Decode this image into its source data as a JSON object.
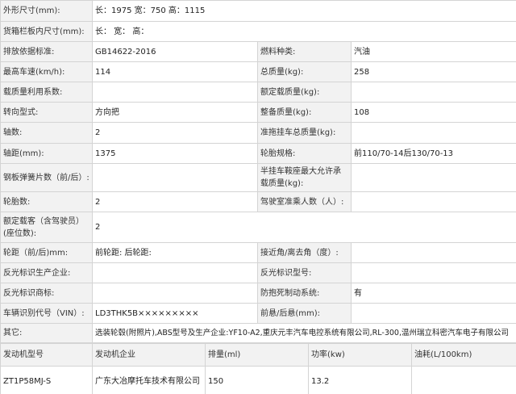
{
  "rows": {
    "dims": {
      "label": "外形尺寸(mm):",
      "value": "长：1975 宽：750 高：1115"
    },
    "cargo_dims": {
      "label": "货箱栏板内尺寸(mm):",
      "value": "长： 宽： 高："
    },
    "standard": {
      "label": "排放依据标准:",
      "value": "GB14622-2016"
    },
    "fuel": {
      "label": "燃料种类:",
      "value": "汽油"
    },
    "max_speed": {
      "label": "最高车速(km/h):",
      "value": "114"
    },
    "total_mass": {
      "label": "总质量(kg):",
      "value": "258"
    },
    "load_util": {
      "label": "载质量利用系数:",
      "value": ""
    },
    "rated_load": {
      "label": "额定载质量(kg):",
      "value": ""
    },
    "steering": {
      "label": "转向型式:",
      "value": "方向把"
    },
    "curb_mass": {
      "label": "整备质量(kg):",
      "value": "108"
    },
    "axles": {
      "label": "轴数:",
      "value": "2"
    },
    "trailer_mass": {
      "label": "准拖挂车总质量(kg):",
      "value": ""
    },
    "wheelbase": {
      "label": "轴距(mm):",
      "value": "1375"
    },
    "tire_spec": {
      "label": "轮胎规格:",
      "value": "前110/70-14后130/70-13"
    },
    "leaf_springs": {
      "label": "钢板弹簧片数（前/后）:",
      "value": ""
    },
    "saddle_load": {
      "label": "半挂车鞍座最大允许承载质量(kg):",
      "value": ""
    },
    "tire_count": {
      "label": "轮胎数:",
      "value": "2"
    },
    "cab_passengers": {
      "label": "驾驶室准乘人数（人）:",
      "value": ""
    },
    "rated_passengers": {
      "label": "额定载客（含驾驶员）(座位数):",
      "value": "2"
    },
    "track": {
      "label": "轮距（前/后)mm:",
      "value": "前轮距: 后轮距:"
    },
    "approach_angle": {
      "label": "接近角/离去角（度）:",
      "value": ""
    },
    "reflector_mfr": {
      "label": "反光标识生产企业:",
      "value": ""
    },
    "reflector_model": {
      "label": "反光标识型号:",
      "value": ""
    },
    "reflector_brand": {
      "label": "反光标识商标:",
      "value": ""
    },
    "abs": {
      "label": "防抱死制动系统:",
      "value": "有"
    },
    "vin": {
      "label": "车辆识别代号（VIN）:",
      "value": "LD3THK5B×××××××××"
    },
    "overhang": {
      "label": "前悬/后悬(mm):",
      "value": ""
    },
    "other": {
      "label": "其它:",
      "value": "选装轮毂(附照片),ABS型号及生产企业:YF10-A2,重庆元丰汽车电控系统有限公司,RL-300,温州瑞立科密汽车电子有限公司"
    }
  },
  "engine": {
    "headers": {
      "model": "发动机型号",
      "company": "发动机企业",
      "displacement": "排量(ml)",
      "power": "功率(kw)",
      "fuel_consumption": "油耗(L/100km)"
    },
    "row": {
      "model": "ZT1P58MJ-S",
      "company": "广东大冶摩托车技术有限公司",
      "displacement": "150",
      "power": "13.2",
      "fuel_consumption": ""
    }
  }
}
